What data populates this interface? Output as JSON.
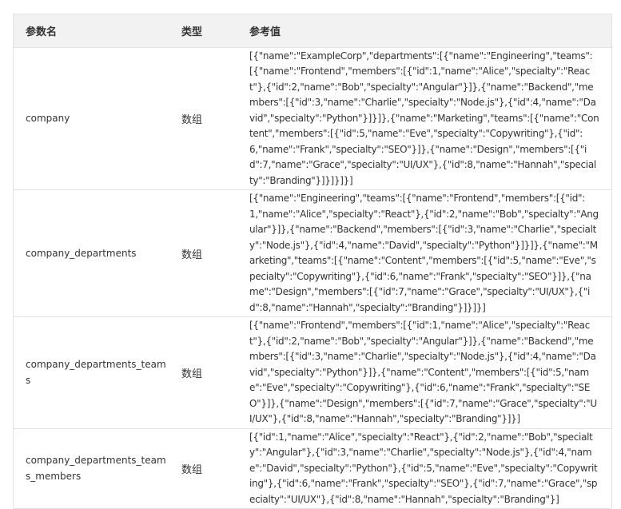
{
  "header": {
    "col_name": "参数名",
    "col_type": "类型",
    "col_value": "参考值"
  },
  "rows": [
    {
      "name": "company",
      "type": "数组",
      "value": "[{\"name\":\"ExampleCorp\",\"departments\":[{\"name\":\"Engineering\",\"teams\":[{\"name\":\"Frontend\",\"members\":[{\"id\":1,\"name\":\"Alice\",\"specialty\":\"React\"},{\"id\":2,\"name\":\"Bob\",\"specialty\":\"Angular\"}]},{\"name\":\"Backend\",\"members\":[{\"id\":3,\"name\":\"Charlie\",\"specialty\":\"Node.js\"},{\"id\":4,\"name\":\"David\",\"specialty\":\"Python\"}]}]},{\"name\":\"Marketing\",\"teams\":[{\"name\":\"Content\",\"members\":[{\"id\":5,\"name\":\"Eve\",\"specialty\":\"Copywriting\"},{\"id\":6,\"name\":\"Frank\",\"specialty\":\"SEO\"}]},{\"name\":\"Design\",\"members\":[{\"id\":7,\"name\":\"Grace\",\"specialty\":\"UI/UX\"},{\"id\":8,\"name\":\"Hannah\",\"specialty\":\"Branding\"}]}]}]}]"
    },
    {
      "name": "company_departments",
      "type": "数组",
      "value": "[{\"name\":\"Engineering\",\"teams\":[{\"name\":\"Frontend\",\"members\":[{\"id\":1,\"name\":\"Alice\",\"specialty\":\"React\"},{\"id\":2,\"name\":\"Bob\",\"specialty\":\"Angular\"}]},{\"name\":\"Backend\",\"members\":[{\"id\":3,\"name\":\"Charlie\",\"specialty\":\"Node.js\"},{\"id\":4,\"name\":\"David\",\"specialty\":\"Python\"}]}]},{\"name\":\"Marketing\",\"teams\":[{\"name\":\"Content\",\"members\":[{\"id\":5,\"name\":\"Eve\",\"specialty\":\"Copywriting\"},{\"id\":6,\"name\":\"Frank\",\"specialty\":\"SEO\"}]},{\"name\":\"Design\",\"members\":[{\"id\":7,\"name\":\"Grace\",\"specialty\":\"UI/UX\"},{\"id\":8,\"name\":\"Hannah\",\"specialty\":\"Branding\"}]}]}]"
    },
    {
      "name": "company_departments_teams",
      "type": "数组",
      "value": "[{\"name\":\"Frontend\",\"members\":[{\"id\":1,\"name\":\"Alice\",\"specialty\":\"React\"},{\"id\":2,\"name\":\"Bob\",\"specialty\":\"Angular\"}]},{\"name\":\"Backend\",\"members\":[{\"id\":3,\"name\":\"Charlie\",\"specialty\":\"Node.js\"},{\"id\":4,\"name\":\"David\",\"specialty\":\"Python\"}]},{\"name\":\"Content\",\"members\":[{\"id\":5,\"name\":\"Eve\",\"specialty\":\"Copywriting\"},{\"id\":6,\"name\":\"Frank\",\"specialty\":\"SEO\"}]},{\"name\":\"Design\",\"members\":[{\"id\":7,\"name\":\"Grace\",\"specialty\":\"UI/UX\"},{\"id\":8,\"name\":\"Hannah\",\"specialty\":\"Branding\"}]}]"
    },
    {
      "name": "company_departments_teams_members",
      "type": "数组",
      "value": "[{\"id\":1,\"name\":\"Alice\",\"specialty\":\"React\"},{\"id\":2,\"name\":\"Bob\",\"specialty\":\"Angular\"},{\"id\":3,\"name\":\"Charlie\",\"specialty\":\"Node.js\"},{\"id\":4,\"name\":\"David\",\"specialty\":\"Python\"},{\"id\":5,\"name\":\"Eve\",\"specialty\":\"Copywriting\"},{\"id\":6,\"name\":\"Frank\",\"specialty\":\"SEO\"},{\"id\":7,\"name\":\"Grace\",\"specialty\":\"UI/UX\"},{\"id\":8,\"name\":\"Hannah\",\"specialty\":\"Branding\"}]"
    }
  ]
}
